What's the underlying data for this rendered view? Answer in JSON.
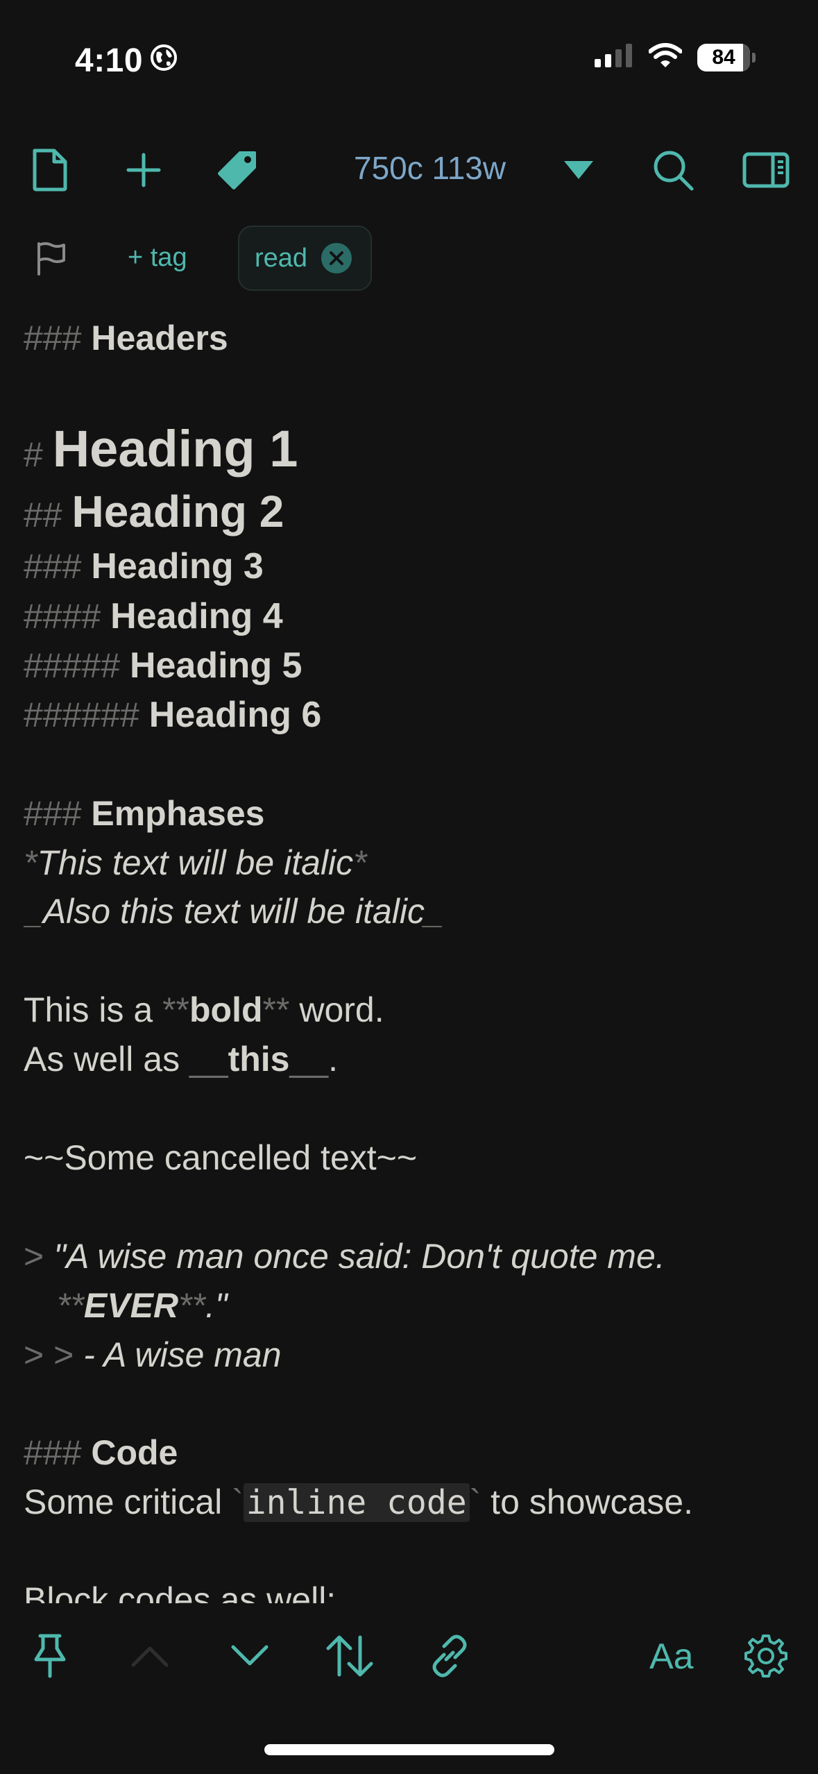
{
  "status_bar": {
    "time": "4:10",
    "battery": "84",
    "icons": [
      "globe-icon",
      "cellular-signal-icon",
      "wifi-icon",
      "battery-icon"
    ]
  },
  "toolbar": {
    "counter": "750c 113w",
    "icons": [
      "new-document-icon",
      "plus-icon",
      "tag-icon",
      "dropdown-triangle-icon",
      "search-icon",
      "sidebar-icon"
    ]
  },
  "tags": {
    "add_label": "+ tag",
    "chips": [
      "read"
    ]
  },
  "editor": {
    "h_headers": {
      "mark": "###",
      "text": "Headers"
    },
    "heading1": {
      "mark": "#",
      "text": "Heading 1"
    },
    "heading2": {
      "mark": "##",
      "text": "Heading 2"
    },
    "heading3": {
      "mark": "###",
      "text": "Heading 3"
    },
    "heading4": {
      "mark": "####",
      "text": "Heading 4"
    },
    "heading5": {
      "mark": "#####",
      "text": "Heading 5"
    },
    "heading6": {
      "mark": "######",
      "text": "Heading 6"
    },
    "h_emphases": {
      "mark": "###",
      "text": "Emphases"
    },
    "italic1": {
      "mark_open": "*",
      "text": "This text will be italic",
      "mark_close": "*"
    },
    "italic2": {
      "mark_open": "_",
      "text": "Also this text will be italic",
      "mark_close": "_"
    },
    "bold1": {
      "before": "This is a ",
      "mark_open": "**",
      "text": "bold",
      "mark_close": "**",
      "after": " word."
    },
    "bold2": {
      "before": "As well as ",
      "mark_open": "__",
      "text": "this",
      "mark_close": "__",
      "after": "."
    },
    "strike": "~~Some cancelled text~~",
    "quote1": {
      "mark": ">",
      "text": "\"A wise man once said: Don't quote me."
    },
    "quote2": {
      "mark_open": "**",
      "text": "EVER",
      "mark_close": "**",
      "after": ".\""
    },
    "quote3": {
      "mark": "> >",
      "text": "- A wise man"
    },
    "h_code": {
      "mark": "###",
      "text": "Code"
    },
    "code_line": {
      "before": "Some critical ",
      "tick_open": "`",
      "code": "inline code",
      "tick_close": "`",
      "after": " to showcase."
    },
    "block_line": "Block codes as well:"
  },
  "bottom_bar": {
    "font_label": "Aa",
    "icons": [
      "pin-icon",
      "chevron-up-icon",
      "chevron-down-icon",
      "sort-arrows-icon",
      "link-icon",
      "gear-icon"
    ]
  },
  "colors": {
    "background": "#121212",
    "accent": "#4fb8ad",
    "counter": "#7da7c9",
    "text": "#d4d3cd",
    "markdown_marker": "#6b6b69"
  }
}
